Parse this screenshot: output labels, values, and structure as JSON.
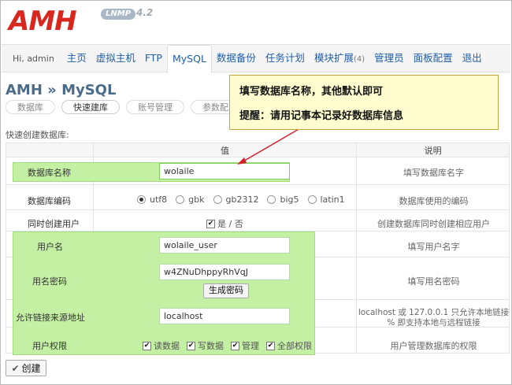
{
  "logo": {
    "text": "AMH",
    "badge": "LNMP",
    "version": "4.2"
  },
  "nav": {
    "greeting": "Hi, admin",
    "items": [
      "主页",
      "虚拟主机",
      "FTP",
      "MySQL",
      "数据备份",
      "任务计划",
      "模块扩展",
      "管理员",
      "面板配置",
      "退出"
    ],
    "module_count": "(4)",
    "active": "MySQL"
  },
  "page": {
    "title": "AMH » MySQL",
    "subtabs": [
      "数据库",
      "快速建库",
      "账号管理",
      "参数配置"
    ],
    "section_label": "快速创建数据库:"
  },
  "callout": {
    "line1": "填写数据库名称，其他默认即可",
    "line2": "提醒：请用记事本记录好数据库信息"
  },
  "table": {
    "headers": [
      "",
      "值",
      "说明"
    ],
    "rows": {
      "dbname": {
        "label": "数据库名称",
        "value": "wolaile",
        "desc": "填写数据库名字"
      },
      "encoding": {
        "label": "数据库编码",
        "options": [
          "utf8",
          "gbk",
          "gb2312",
          "big5",
          "latin1"
        ],
        "selected": "utf8",
        "desc": "数据库使用的编码"
      },
      "create_user": {
        "label": "同时创建用户",
        "value": "是 / 否",
        "desc": "创建数据库同时创建相应用户"
      },
      "username": {
        "label": "用户名",
        "value": "wolaile_user",
        "desc": "填写用户名字"
      },
      "password": {
        "label": "用名密码",
        "value": "w4ZNuDhppyRhVqJ",
        "button": "生成密码",
        "desc": "填写用名密码"
      },
      "host": {
        "label": "允许链接来源地址",
        "value": "localhost",
        "desc1": "localhost 或 127.0.0.1 只允许本地链接",
        "desc2": "% 即支持本地与远程链接"
      },
      "privileges": {
        "label": "用户权限",
        "options": [
          "读数据",
          "写数据",
          "管理",
          "全部权限"
        ],
        "desc": "用户管理数据库的权限"
      }
    }
  },
  "create_button": "创建",
  "colors": {
    "accent": "#d8271e",
    "link": "#1f5ea8",
    "highlight": "#c4f0a4",
    "callout_bg": "#fffdd0",
    "arrow": "#d0202a"
  }
}
